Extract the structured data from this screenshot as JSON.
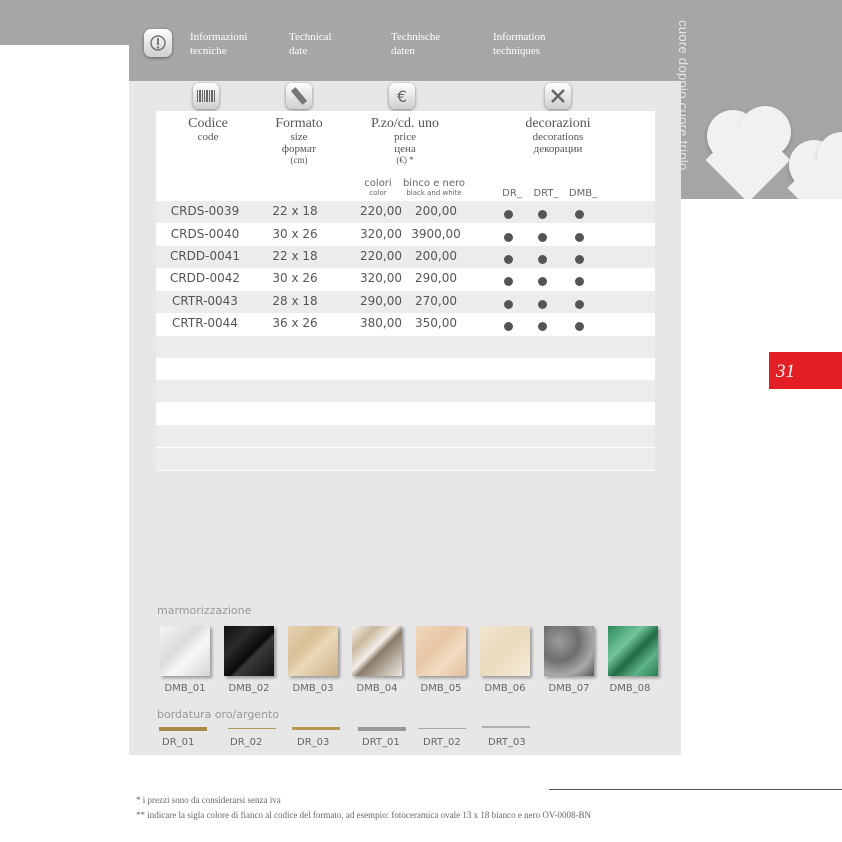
{
  "header": {
    "items": [
      {
        "line1": "Informazioni",
        "line2": "tecniche"
      },
      {
        "line1": "Technical",
        "line2": "date"
      },
      {
        "line1": "Technische",
        "line2": "daten"
      },
      {
        "line1": "Information",
        "line2": "techniques"
      }
    ],
    "side_title": "cuore doppio cuore triplo"
  },
  "table": {
    "columns": {
      "code": {
        "title": "Codice",
        "sub1": "code"
      },
      "format": {
        "title": "Formato",
        "sub1": "size",
        "sub2": "формат",
        "sub3": "(cm)"
      },
      "price": {
        "title": "P.zo/cd. uno",
        "sub1": "price",
        "sub2": "цена",
        "sub3": "(€) *"
      },
      "decor": {
        "title": "decorazioni",
        "sub1": "decorations",
        "sub2": "декорации"
      }
    },
    "price_sub": {
      "colori": "colori",
      "color": "color",
      "bw": "binco e nero",
      "bw_en": "black and white"
    },
    "decor_sub": [
      "DR_",
      "DRT_",
      "DMB_"
    ],
    "rows": [
      {
        "code": "CRDS-0039",
        "size": "22 x 18",
        "color": "220,00",
        "bw": "200,00"
      },
      {
        "code": "CRDS-0040",
        "size": "30 x 26",
        "color": "320,00",
        "bw": "3900,00"
      },
      {
        "code": "CRDD-0041",
        "size": "22 x 18",
        "color": "220,00",
        "bw": "200,00"
      },
      {
        "code": "CRDD-0042",
        "size": "30 x 26",
        "color": "320,00",
        "bw": "290,00"
      },
      {
        "code": "CRTR-0043",
        "size": "28 x 18",
        "color": "290,00",
        "bw": "270,00"
      },
      {
        "code": "CRTR-0044",
        "size": "36 x 26",
        "color": "380,00",
        "bw": "350,00"
      }
    ]
  },
  "marble": {
    "label": "marmorizzazione",
    "items": [
      "DMB_01",
      "DMB_02",
      "DMB_03",
      "DMB_04",
      "DMB_05",
      "DMB_06",
      "DMB_07",
      "DMB_08"
    ]
  },
  "border": {
    "label": "bordatura oro/argento",
    "items": [
      "DR_01",
      "DR_02",
      "DR_03",
      "DRT_01",
      "DRT_02",
      "DRT_03"
    ]
  },
  "page_number": "31",
  "notes": {
    "n1": "* i prezzi sono da considerarsi senza iva",
    "n2": "** indicare la sigla colore di fianco al codice del formato, ad esempio: fotoceramica ovale 13 x 18 bianco e nero OV-0008-BN"
  },
  "colors": {
    "accent": "#e31e24",
    "panel": "#e8e7e8",
    "bar": "#a7a7a8"
  }
}
